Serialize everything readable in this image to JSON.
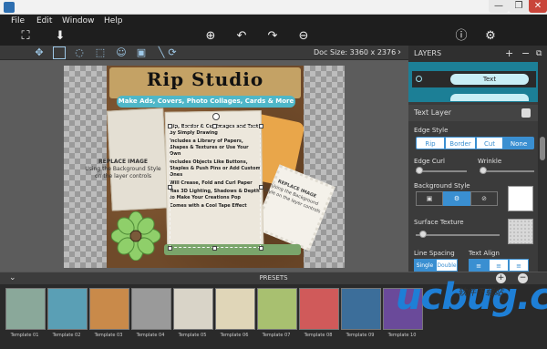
{
  "menu": [
    "File",
    "Edit",
    "Window",
    "Help"
  ],
  "window_controls": {
    "minimize": "—",
    "maximize": "❐",
    "close": "✕"
  },
  "toolbar_icons": [
    "crop-icon",
    "save-icon",
    "zoom-in-icon",
    "undo-icon",
    "redo-icon",
    "zoom-out-icon",
    "info-icon",
    "settings-icon"
  ],
  "toolrow_icons": [
    "move-icon",
    "rect-select-icon",
    "lasso-icon",
    "stamp-icon",
    "person-icon",
    "image-icon",
    "line-icon",
    "rotate-icon"
  ],
  "doc_size": "Doc Size: 3360 x 2376",
  "canvas": {
    "title": "Rip Studio",
    "subtitle": "Make Ads, Covers, Photo Collages, Cards & More",
    "paper_lines": [
      "Rip, Border & Cut Images and Text by Simply Drawing",
      "Includes a Library of Papers, Shapes & Textures or Use Your Own",
      "Includes Objects Like Buttons, Staples & Push Pins or Add Custom Ones",
      "Will Crease, Fold and Curl Paper",
      "Has 3D Lighting, Shadows & Depth to Make Your Creations Pop",
      "Comes with a Cool Tape Effect"
    ],
    "replace_left_title": "REPLACE IMAGE",
    "replace_left_body": "Using the Background Style on the layer controls",
    "replace_right_title": "REPLACE IMAGE",
    "replace_right_body": "Using the Background Style on the layer controls"
  },
  "layers": {
    "title": "LAYERS",
    "add": "+",
    "remove": "−",
    "dup": "⧉",
    "item_label": "Text"
  },
  "text_layer": {
    "title": "Text Layer",
    "edge_style_label": "Edge Style",
    "edge_options": [
      "Rip",
      "Border",
      "Cut",
      "None"
    ],
    "edge_selected": "None",
    "edge_curl_label": "Edge Curl",
    "wrinkle_label": "Wrinkle",
    "edge_curl_value": 0.0,
    "wrinkle_value": 0.0,
    "background_style_label": "Background Style",
    "surface_texture_label": "Surface Texture",
    "surface_texture_value": 0.05,
    "line_spacing_label": "Line Spacing",
    "text_align_label": "Text Align",
    "line_spacing_options": [
      "Single",
      "Double"
    ],
    "line_spacing_selected": "Single"
  },
  "presets": {
    "title": "PRESETS",
    "templates": [
      "Template 01",
      "Template 02",
      "Template 03",
      "Template 04",
      "Template 05",
      "Template 06",
      "Template 07",
      "Template 08",
      "Template 09",
      "Template 10"
    ]
  },
  "watermark": {
    "logo": "ucbug.cc",
    "caption": "软件下载站"
  },
  "colors": {
    "accent": "#3a8fd1",
    "layer_highlight": "#1c7f96",
    "close": "#c9453a"
  }
}
